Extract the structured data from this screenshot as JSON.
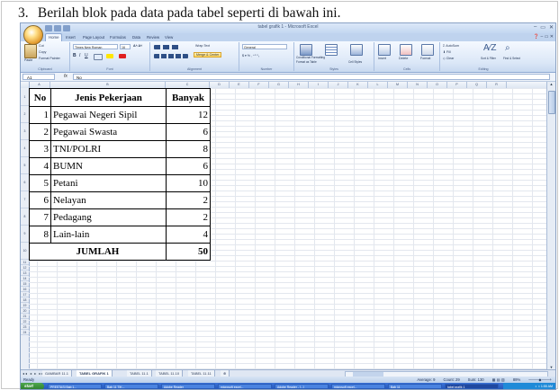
{
  "instruction": {
    "number": "3.",
    "text": "Berilah blok pada data pada tabel seperti di bawah ini."
  },
  "window": {
    "title": "tabel grafik 1 - Microsoft Excel",
    "controls": [
      "–",
      "▭",
      "✕"
    ]
  },
  "qat_icons": [
    "save-icon",
    "undo-icon",
    "redo-icon"
  ],
  "tabs": [
    "Home",
    "Insert",
    "Page Layout",
    "Formulas",
    "Data",
    "Review",
    "View"
  ],
  "ribbon": {
    "clipboard": {
      "label": "Clipboard",
      "paste": "Paste",
      "cut": "Cut",
      "copy": "Copy",
      "format_painter": "Format Painter"
    },
    "font": {
      "label": "Font",
      "name": "Times New Roman",
      "size": "16"
    },
    "alignment": {
      "label": "Alignment",
      "wrap": "Wrap Text",
      "merge": "Merge & Center"
    },
    "number": {
      "label": "Number",
      "format": "General"
    },
    "styles": {
      "label": "Styles",
      "conditional": "Conditional Formatting",
      "format_table": "Format as Table",
      "cell_styles": "Cell Styles"
    },
    "cells": {
      "label": "Cells",
      "insert": "Insert",
      "delete": "Delete",
      "format": "Format"
    },
    "editing": {
      "label": "Editing",
      "autosum": "AutoSum",
      "fill": "Fill",
      "clear": "Clear",
      "sort": "Sort & Filter",
      "find": "Find & Select"
    }
  },
  "formula_bar": {
    "cell": "A1",
    "fx": "fx",
    "value": "No"
  },
  "columns": [
    "A",
    "B",
    "C",
    "D",
    "E",
    "F",
    "G",
    "H",
    "I",
    "J",
    "K",
    "L",
    "M",
    "N",
    "O",
    "P",
    "Q",
    "R"
  ],
  "rows": [
    "1",
    "2",
    "3",
    "4",
    "5",
    "6",
    "7",
    "8",
    "9",
    "10",
    "11",
    "12",
    "13",
    "14",
    "15",
    "16",
    "17",
    "18",
    "19",
    "20",
    "21",
    "22",
    "23",
    "24"
  ],
  "table": {
    "headers": {
      "no": "No",
      "job": "Jenis Pekerjaan",
      "count": "Banyak"
    },
    "rows": [
      {
        "no": "1",
        "job": "Pegawai Negeri Sipil",
        "count": "12"
      },
      {
        "no": "2",
        "job": "Pegawai Swasta",
        "count": "6"
      },
      {
        "no": "3",
        "job": "TNI/POLRI",
        "count": "8"
      },
      {
        "no": "4",
        "job": "BUMN",
        "count": "6"
      },
      {
        "no": "5",
        "job": "Petani",
        "count": "10"
      },
      {
        "no": "6",
        "job": "Nelayan",
        "count": "2"
      },
      {
        "no": "7",
        "job": "Pedagang",
        "count": "2"
      },
      {
        "no": "8",
        "job": "Lain-lain",
        "count": "4"
      }
    ],
    "total": {
      "label": "JUMLAH",
      "value": "50"
    }
  },
  "sheet_tabs": [
    "GAMBAR 11.1",
    "TABEL GRAFIK 1",
    "TABEL 11.1",
    "TABEL 11.10",
    "TABEL 11.11"
  ],
  "status": {
    "ready": "Ready",
    "average": "Average: 9",
    "count": "Count: 29",
    "sum": "Sum: 130",
    "zoom": "89%"
  },
  "taskbar": {
    "start": "start",
    "tasks": [
      "PRESTASI Bab 1...",
      "Bab 11 TIK...",
      "Adobe Reader",
      "microsoft excel...",
      "Adobe Reader - [...]",
      "microsoft excel...",
      "Bab 11",
      "tabel grafik 1"
    ],
    "clock": "1:55 AM"
  }
}
